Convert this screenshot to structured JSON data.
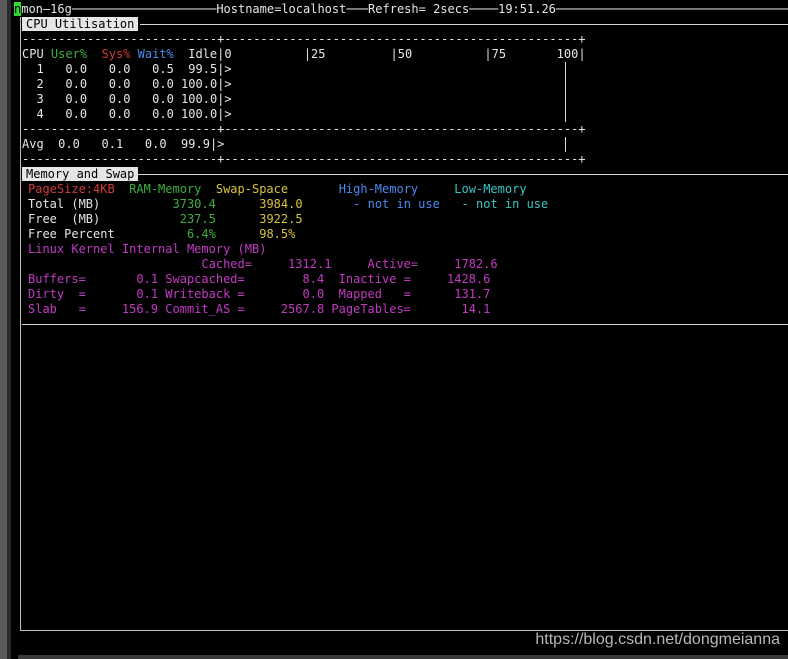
{
  "header": {
    "cursor_char": "n",
    "app": "mon—16g",
    "hostname": "Hostname=localhost",
    "refresh": "Refresh= 2secs",
    "time": "19:51.26"
  },
  "cpu": {
    "title": "CPU Utilisation",
    "dash_row": "---------------------------+-------------------------------------------------+",
    "cols": {
      "cpu": "CPU",
      "user": "User%",
      "sys": "Sys%",
      "wait": "Wait%",
      "idle": "Idle"
    },
    "scale": "|0          |25         |50          |75       100|",
    "rows": [
      {
        "id": " 1",
        "user": "0.0",
        "sys": "0.0",
        "wait": "0.5",
        "idle": " 99.5",
        "bar": "|>"
      },
      {
        "id": " 2",
        "user": "0.0",
        "sys": "0.0",
        "wait": "0.0",
        "idle": "100.0",
        "bar": "|>"
      },
      {
        "id": " 3",
        "user": "0.0",
        "sys": "0.0",
        "wait": "0.0",
        "idle": "100.0",
        "bar": "|>"
      },
      {
        "id": " 4",
        "user": "0.0",
        "sys": "0.0",
        "wait": "0.0",
        "idle": "100.0",
        "bar": "|>"
      }
    ],
    "avg": {
      "id": "Avg",
      "user": "0.0",
      "sys": "0.1",
      "wait": "0.0",
      "idle": " 99.9",
      "bar": "|>"
    }
  },
  "mem": {
    "title": "Memory and Swap",
    "page_size": "PageSize:4KB",
    "ram": "RAM-Memory",
    "swap": "Swap-Space",
    "high": "High-Memory",
    "low": "Low-Memory",
    "total_label": "Total (MB)",
    "total_ram": "3730.4",
    "total_swap": "3984.0",
    "high_val": "- not in use",
    "low_val": "- not in use",
    "free_label": "Free  (MB)",
    "free_ram": "237.5",
    "free_swap": "3922.5",
    "pct_label": "Free Percent",
    "pct_ram": "6.4%",
    "pct_swap": "98.5%",
    "kernel_title": "Linux Kernel Internal Memory (MB)",
    "k_row1": "                        Cached=     1312.1     Active=     1782.6",
    "k_row2": "Buffers=       0.1 Swapcached=        8.4  Inactive =     1428.6",
    "k_row3": "Dirty  =       0.1 Writeback =        0.0  Mapped   =      131.7",
    "k_row4": "Slab   =     156.9 Commit_AS =     2567.8 PageTables=       14.1"
  },
  "watermark": "https://blog.csdn.net/dongmeianna"
}
